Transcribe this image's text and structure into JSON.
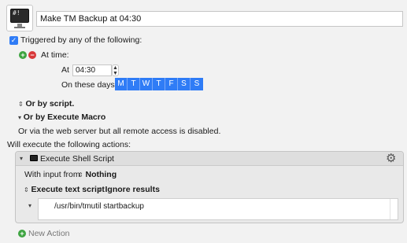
{
  "macro": {
    "icon_glyph": "#!",
    "name": "Make TM Backup at 04:30"
  },
  "trigger": {
    "checkbox_glyph": "✓",
    "label": "Triggered by any of the following:",
    "at_time_label": "At time:",
    "at_label": "At",
    "time_value": "04:30",
    "on_days_label": "On these days:",
    "days": [
      "M",
      "T",
      "W",
      "T",
      "F",
      "S",
      "S"
    ],
    "or_by_script": "Or by script.",
    "or_by_execute_macro": "Or by Execute Macro",
    "web_server_note": "Or via the web server but all remote access is disabled."
  },
  "actions": {
    "heading": "Will execute the following actions:",
    "action_title": "Execute Shell Script",
    "with_input_label": "With input from",
    "with_input_value": "Nothing",
    "execute_mode": "Execute text script",
    "result_mode": "Ignore results",
    "script": "/usr/bin/tmutil startbackup"
  },
  "footer": {
    "new_action_label": "New Action"
  },
  "colors": {
    "accent": "#2f7cf6",
    "add_green": "#3ea441",
    "remove_red": "#d8383a"
  },
  "icons": {
    "disclosure": "▾",
    "updown": "⌃⌄",
    "gear": "⚙"
  }
}
